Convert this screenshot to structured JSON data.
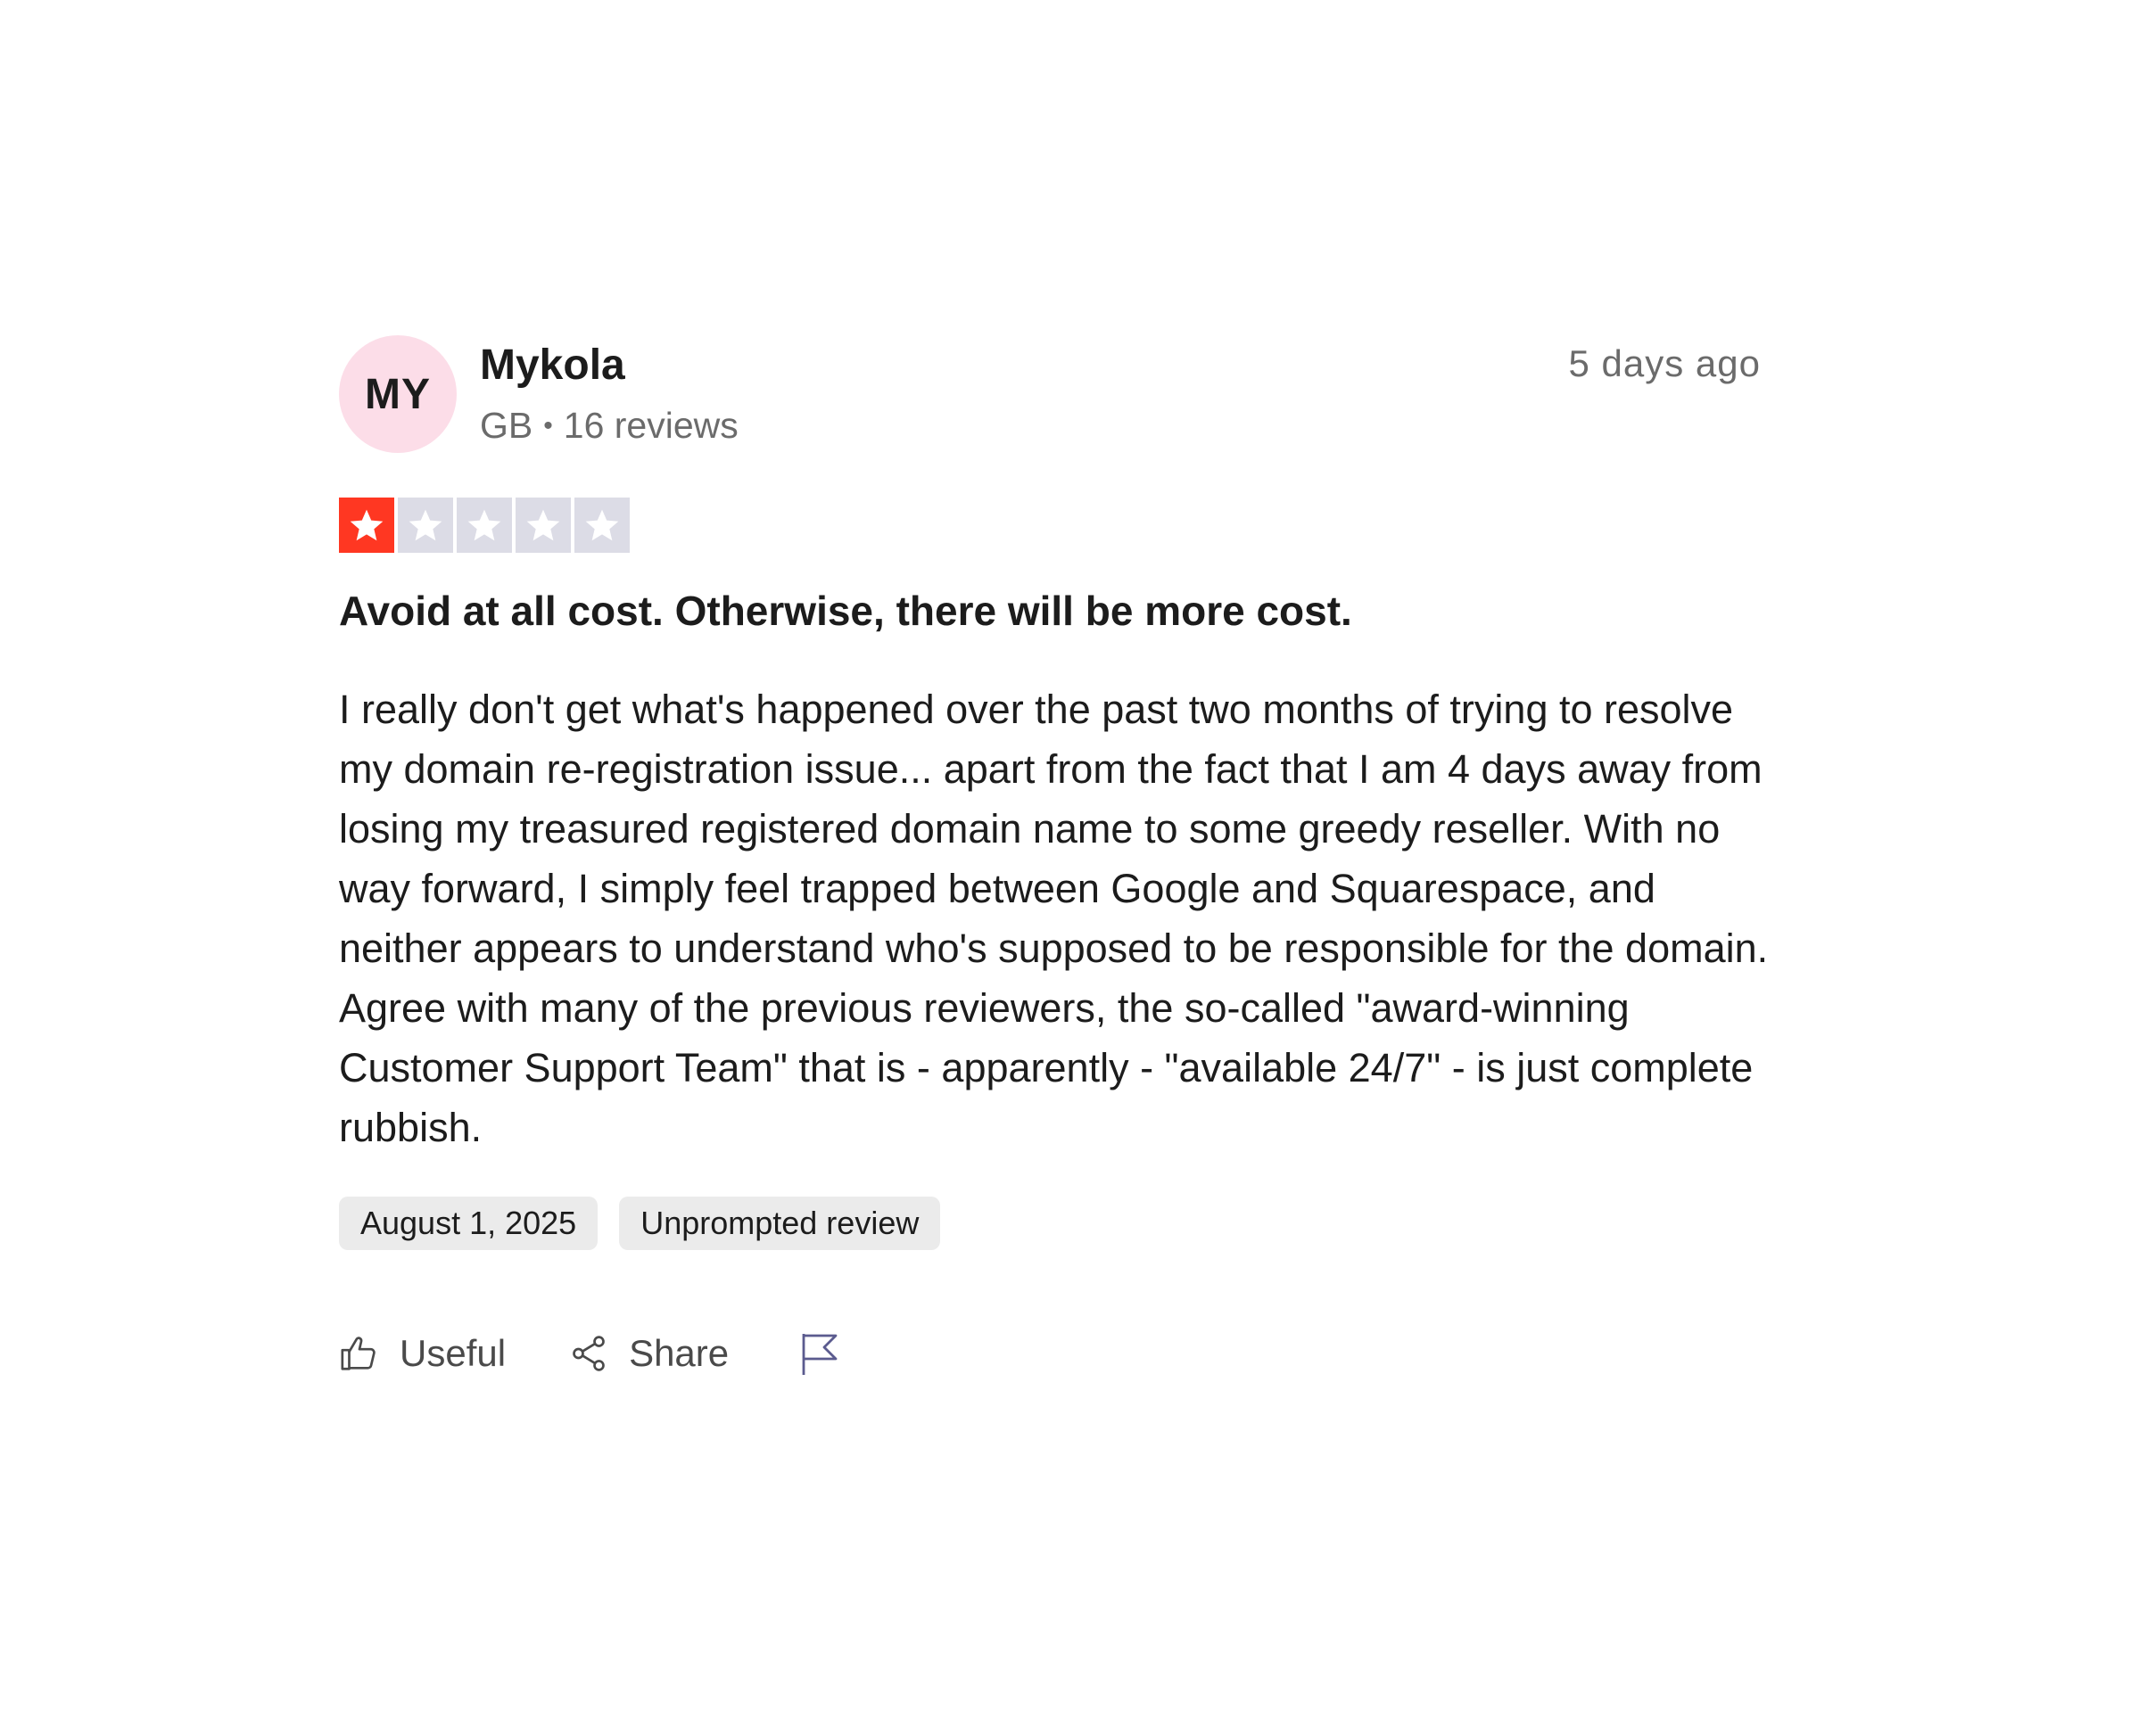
{
  "review": {
    "author": {
      "initials": "MY",
      "name": "Mykola",
      "country": "GB",
      "separator": "•",
      "reviews_count": "16 reviews",
      "avatar_color": "#fcdde8"
    },
    "date_relative": "5 days ago",
    "rating": {
      "value": 1,
      "max": 5,
      "filled_color": "#ff3722",
      "empty_color": "#dcdce6"
    },
    "title": "Avoid at all cost. Otherwise, there will be more cost.",
    "body": "I really don't get what's happened over the past two months of trying to resolve my domain re-registration issue... apart from the fact that I am 4 days away from losing my treasured registered domain name to some greedy reseller. With no way forward, I simply feel trapped between Google and Squarespace, and neither appears to understand who's supposed to be responsible for the domain. Agree with many of the previous reviewers, the so-called \"award-winning Customer Support Team\" that is - apparently - \"available 24/7\" - is just complete rubbish.",
    "tags": {
      "date": "August 1, 2025",
      "type": "Unprompted review"
    },
    "actions": {
      "useful_label": "Useful",
      "useful_icon": "thumbs-up-icon",
      "share_label": "Share",
      "share_icon": "share-icon",
      "report_icon": "flag-icon"
    }
  }
}
